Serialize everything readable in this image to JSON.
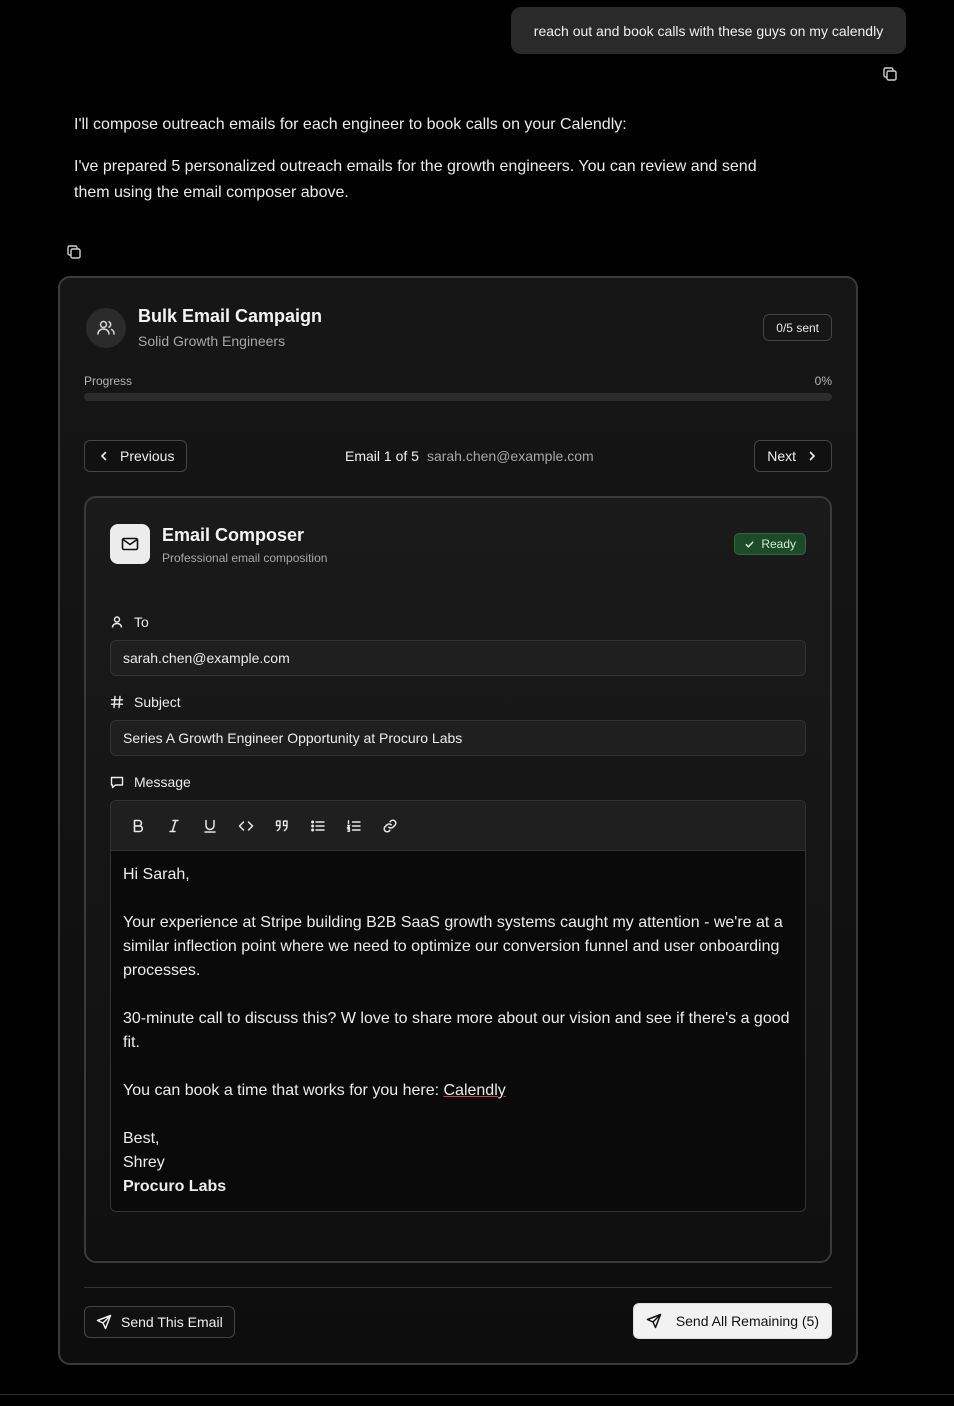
{
  "chat": {
    "user_message": "reach out and book calls with these guys on my calendly",
    "assistant_line1": "I'll compose outreach emails for each engineer to book calls on your Calendly:",
    "assistant_line2": "I've prepared 5 personalized outreach emails for the growth engineers. You can review and send them using the email composer above."
  },
  "campaign": {
    "title": "Bulk Email Campaign",
    "subtitle": "Solid Growth Engineers",
    "sent_badge": "0/5 sent",
    "progress_label": "Progress",
    "progress_pct": "0%",
    "progress_value": 0,
    "prev_label": "Previous",
    "next_label": "Next",
    "position_label": "Email 1 of 5",
    "position_address": "sarah.chen@example.com"
  },
  "composer": {
    "title": "Email Composer",
    "subtitle": "Professional email composition",
    "status": "Ready",
    "to_label": "To",
    "to_value": "sarah.chen@example.com",
    "subject_label": "Subject",
    "subject_value": "Series A Growth Engineer Opportunity at Procuro Labs",
    "message_label": "Message",
    "toolbar": [
      "bold-icon",
      "italic-icon",
      "underline-icon",
      "code-icon",
      "quote-icon",
      "bullet-list-icon",
      "numbered-list-icon",
      "link-icon"
    ],
    "body": {
      "greeting": "Hi Sarah,",
      "para1": "Your experience at Stripe building B2B SaaS growth systems caught my attention - we're at a similar inflection point where we need to optimize our conversion funnel and user onboarding processes.",
      "para2": "30-minute call to discuss this? W love to share more about our vision and see if there's a good fit.",
      "para3_prefix": "You can book a time that works for you here: ",
      "link_text": "Calendly",
      "signoff": "Best,",
      "name": "Shrey",
      "company": "Procuro Labs"
    }
  },
  "actions": {
    "send_this": "Send This Email",
    "send_all": "Send All Remaining (5)"
  },
  "colors": {
    "background": "#000000",
    "card": "#161616",
    "ready_badge": "#1c4a2a",
    "primary_button": "#f2f2f2"
  }
}
